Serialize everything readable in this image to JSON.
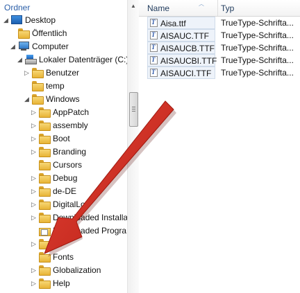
{
  "left_pane": {
    "header": "Ordner",
    "tree": [
      {
        "label": "Desktop",
        "icon": "desktop-icon",
        "expander": "◢",
        "indent": 0
      },
      {
        "label": "Öffentlich",
        "icon": "folder-icon",
        "expander": "",
        "indent": 1
      },
      {
        "label": "Computer",
        "icon": "computer-icon",
        "expander": "◢",
        "indent": 1
      },
      {
        "label": "Lokaler Datenträger (C:)",
        "icon": "drive-icon",
        "expander": "◢",
        "indent": 2
      },
      {
        "label": "Benutzer",
        "icon": "folder-icon",
        "expander": "▷",
        "indent": 3
      },
      {
        "label": "temp",
        "icon": "folder-icon",
        "expander": "",
        "indent": 3
      },
      {
        "label": "Windows",
        "icon": "folder-icon",
        "expander": "◢",
        "indent": 3
      },
      {
        "label": "AppPatch",
        "icon": "folder-icon",
        "expander": "▷",
        "indent": 4
      },
      {
        "label": "assembly",
        "icon": "folder-icon",
        "expander": "▷",
        "indent": 4
      },
      {
        "label": "Boot",
        "icon": "folder-icon",
        "expander": "▷",
        "indent": 4
      },
      {
        "label": "Branding",
        "icon": "folder-icon",
        "expander": "▷",
        "indent": 4
      },
      {
        "label": "Cursors",
        "icon": "folder-icon",
        "expander": "",
        "indent": 4
      },
      {
        "label": "Debug",
        "icon": "folder-icon",
        "expander": "▷",
        "indent": 4
      },
      {
        "label": "de-DE",
        "icon": "folder-icon",
        "expander": "▷",
        "indent": 4
      },
      {
        "label": "DigitalLo",
        "icon": "folder-icon",
        "expander": "▷",
        "indent": 4
      },
      {
        "label": "Downloaded Installat",
        "icon": "folder-icon",
        "expander": "▷",
        "indent": 4
      },
      {
        "label": "Downloaded Progra",
        "icon": "special-folder-icon",
        "expander": "",
        "indent": 4
      },
      {
        "label": "eh",
        "icon": "folder-icon",
        "expander": "▷",
        "indent": 4
      },
      {
        "label": "Fonts",
        "icon": "folder-icon",
        "expander": "",
        "indent": 4
      },
      {
        "label": "Globalization",
        "icon": "folder-icon",
        "expander": "▷",
        "indent": 4
      },
      {
        "label": "Help",
        "icon": "folder-icon",
        "expander": "▷",
        "indent": 4
      }
    ],
    "scroll_up": "▲"
  },
  "right_pane": {
    "columns": {
      "name": "Name",
      "type": "Typ",
      "sort_indicator": "︿"
    },
    "files": [
      {
        "name": "Aisa.ttf",
        "type": "TrueType-Schrifta...",
        "icon": "truetype-font-icon",
        "glyph": "T"
      },
      {
        "name": "AISAUC.TTF",
        "type": "TrueType-Schrifta...",
        "icon": "truetype-font-icon",
        "glyph": "T"
      },
      {
        "name": "AISAUCB.TTF",
        "type": "TrueType-Schrifta...",
        "icon": "truetype-font-icon",
        "glyph": "T"
      },
      {
        "name": "AISAUCBI.TTF",
        "type": "TrueType-Schrifta...",
        "icon": "truetype-font-icon",
        "glyph": "T"
      },
      {
        "name": "AISAUCI.TTF",
        "type": "TrueType-Schrifta...",
        "icon": "truetype-font-icon",
        "glyph": "T"
      }
    ]
  },
  "colors": {
    "header_text": "#2a5ea8",
    "arrow_red": "#d42b1e",
    "selection_fill": "#eef3fa",
    "folder_yellow": "#e8b437"
  }
}
